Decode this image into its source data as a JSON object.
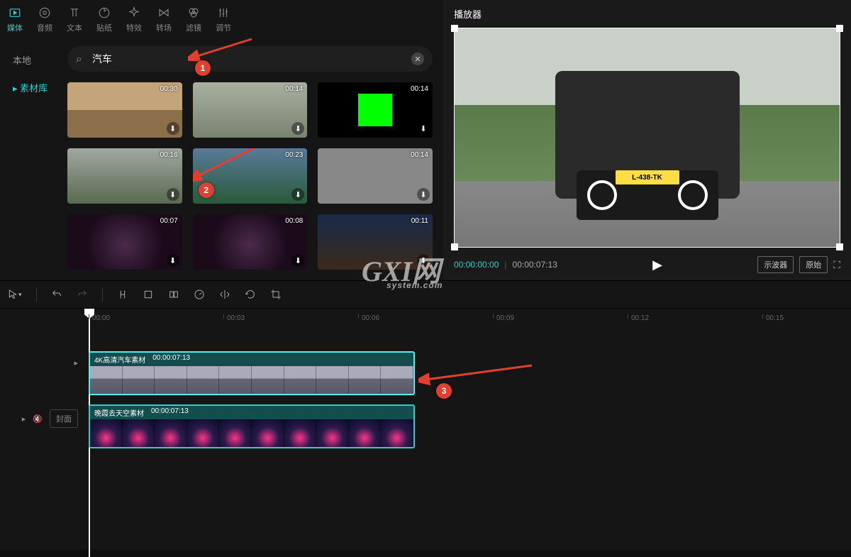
{
  "tabs": [
    {
      "id": "media",
      "label": "媒体"
    },
    {
      "id": "audio",
      "label": "音频"
    },
    {
      "id": "text",
      "label": "文本"
    },
    {
      "id": "sticker",
      "label": "贴纸"
    },
    {
      "id": "effect",
      "label": "特效"
    },
    {
      "id": "transition",
      "label": "转场"
    },
    {
      "id": "filter",
      "label": "滤镜"
    },
    {
      "id": "adjust",
      "label": "调节"
    }
  ],
  "sidebar": {
    "local": "本地",
    "library": "素材库"
  },
  "search": {
    "value": "汽车",
    "placeholder": ""
  },
  "thumbs": [
    {
      "dur": "00:30"
    },
    {
      "dur": "00:14"
    },
    {
      "dur": "00:14"
    },
    {
      "dur": "00:16"
    },
    {
      "dur": "00:23"
    },
    {
      "dur": "00:14"
    },
    {
      "dur": "00:07"
    },
    {
      "dur": "00:08"
    },
    {
      "dur": "00:11"
    }
  ],
  "player": {
    "title": "播放器",
    "plate": "L-438-TK",
    "current": "00:00:00:00",
    "total": "00:00:07:13",
    "scope": "示波器",
    "original": "原始"
  },
  "ruler": [
    "00:00",
    "00:03",
    "00:06",
    "00:09",
    "00:12",
    "00:15"
  ],
  "clips": [
    {
      "name": "4K高清汽车素材",
      "dur": "00:00:07:13"
    },
    {
      "name": "晚霞去天空素材",
      "dur": "00:00:07:13"
    }
  ],
  "tlside": {
    "cover": "封面"
  },
  "badges": [
    "1",
    "2",
    "3"
  ],
  "watermark": {
    "main": "GXI网",
    "sub": "system.com"
  }
}
